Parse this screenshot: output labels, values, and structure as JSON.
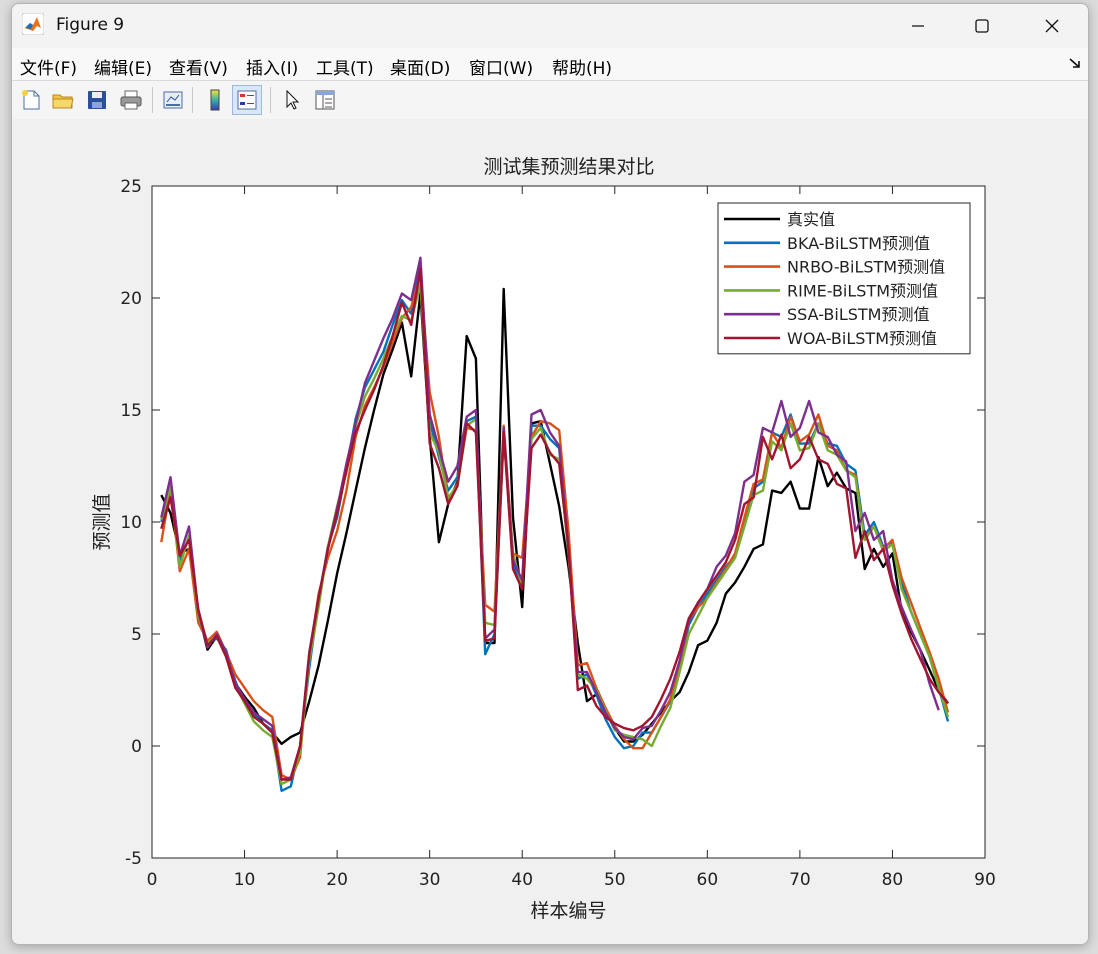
{
  "window": {
    "title": "Figure 9"
  },
  "menu": [
    "文件(F)",
    "编辑(E)",
    "查看(V)",
    "插入(I)",
    "工具(T)",
    "桌面(D)",
    "窗口(W)",
    "帮助(H)"
  ],
  "toolbar": [
    "new-figure",
    "open-file",
    "save",
    "print",
    "link-plot",
    "colorbar",
    "legend",
    "edit-plot",
    "property-inspector"
  ],
  "chart_data": {
    "type": "line",
    "title": "测试集预测结果对比",
    "xlabel": "样本编号",
    "ylabel": "预测值",
    "xlim": [
      0,
      90
    ],
    "ylim": [
      -5,
      25
    ],
    "xticks": [
      0,
      10,
      20,
      30,
      40,
      50,
      60,
      70,
      80,
      90
    ],
    "yticks": [
      -5,
      0,
      5,
      10,
      15,
      20,
      25
    ],
    "legend_position": "top-right",
    "grid": false,
    "x": [
      1,
      2,
      3,
      4,
      5,
      6,
      7,
      8,
      9,
      10,
      11,
      12,
      13,
      14,
      15,
      16,
      17,
      18,
      19,
      20,
      21,
      22,
      23,
      24,
      25,
      26,
      27,
      28,
      29,
      30,
      31,
      32,
      33,
      34,
      35,
      36,
      37,
      38,
      39,
      40,
      41,
      42,
      43,
      44,
      45,
      46,
      47,
      48,
      49,
      50,
      51,
      52,
      53,
      54,
      55,
      56,
      57,
      58,
      59,
      60,
      61,
      62,
      63,
      64,
      65,
      66,
      67,
      68,
      69,
      70,
      71,
      72,
      73,
      74,
      75,
      76,
      77,
      78,
      79,
      80,
      81,
      82,
      83,
      84,
      85,
      86
    ],
    "series": [
      {
        "name": "真实值",
        "color": "#000000",
        "values": [
          11.2,
          10.4,
          8.6,
          8.8,
          6.0,
          4.3,
          4.9,
          4.0,
          2.8,
          2.2,
          1.7,
          1.0,
          0.6,
          0.1,
          0.4,
          0.6,
          2.0,
          3.6,
          5.6,
          7.7,
          9.5,
          11.4,
          13.3,
          15.0,
          16.6,
          17.7,
          18.9,
          16.5,
          20.2,
          13.8,
          9.1,
          10.8,
          11.8,
          18.3,
          17.3,
          4.6,
          4.6,
          20.4,
          10.2,
          6.2,
          14.4,
          14.5,
          12.6,
          10.7,
          8.0,
          4.6,
          2.0,
          2.3,
          1.5,
          0.8,
          0.2,
          0.2,
          0.5,
          1.0,
          1.5,
          2.0,
          2.4,
          3.3,
          4.5,
          4.7,
          5.5,
          6.8,
          7.3,
          8.0,
          8.8,
          9.0,
          11.4,
          11.3,
          11.8,
          10.6,
          10.6,
          12.9,
          11.6,
          12.2,
          11.5,
          11.3,
          7.9,
          8.8,
          8.0,
          8.6,
          6.0,
          5.1,
          4.3,
          3.4,
          2.5,
          1.9
        ]
      },
      {
        "name": "BKA-BiLSTM预测值",
        "color": "#0072BD",
        "values": [
          10.0,
          11.3,
          8.3,
          9.3,
          5.9,
          4.6,
          4.8,
          4.3,
          2.9,
          1.9,
          1.4,
          1.0,
          0.7,
          -2.0,
          -1.8,
          0.0,
          3.5,
          6.5,
          8.9,
          10.2,
          12.4,
          14.6,
          16.0,
          16.8,
          17.6,
          18.8,
          19.9,
          19.3,
          21.5,
          14.5,
          12.9,
          11.4,
          12.0,
          14.5,
          14.7,
          4.1,
          5.0,
          14.0,
          8.1,
          7.2,
          14.3,
          14.3,
          13.7,
          13.3,
          8.6,
          3.0,
          3.2,
          2.3,
          1.2,
          0.4,
          -0.1,
          0.0,
          0.6,
          0.6,
          1.3,
          2.0,
          3.6,
          5.4,
          6.2,
          6.8,
          7.4,
          8.0,
          8.5,
          10.0,
          11.5,
          11.8,
          14.0,
          13.8,
          14.8,
          13.5,
          13.5,
          14.4,
          13.5,
          13.4,
          12.6,
          12.3,
          9.4,
          10.0,
          8.9,
          9.1,
          7.3,
          6.0,
          5.0,
          4.0,
          2.6,
          1.1
        ]
      },
      {
        "name": "NRBO-BiLSTM预测值",
        "color": "#D95319",
        "values": [
          9.1,
          11.5,
          7.8,
          8.8,
          5.5,
          4.7,
          5.1,
          4.2,
          3.2,
          2.6,
          2.0,
          1.6,
          1.3,
          -1.3,
          -1.5,
          -0.5,
          4.0,
          6.8,
          8.4,
          9.6,
          11.4,
          13.8,
          15.2,
          16.0,
          16.9,
          18.0,
          19.1,
          19.6,
          21.0,
          15.8,
          13.8,
          11.0,
          11.7,
          14.2,
          14.1,
          6.3,
          6.0,
          14.3,
          8.6,
          8.4,
          13.8,
          14.5,
          14.4,
          14.1,
          9.6,
          3.6,
          3.7,
          2.6,
          1.7,
          0.9,
          0.3,
          -0.1,
          -0.1,
          0.6,
          1.3,
          2.1,
          3.6,
          5.6,
          6.2,
          6.6,
          7.3,
          7.9,
          8.6,
          10.2,
          11.7,
          11.9,
          14.0,
          13.3,
          14.7,
          13.6,
          13.9,
          14.8,
          13.4,
          13.2,
          12.3,
          12.1,
          9.2,
          9.8,
          8.8,
          9.2,
          7.5,
          6.4,
          5.3,
          4.2,
          3.0,
          1.5
        ]
      },
      {
        "name": "RIME-BiLSTM预测值",
        "color": "#77AC30",
        "values": [
          10.1,
          11.6,
          8.0,
          9.4,
          5.8,
          4.6,
          4.9,
          4.0,
          2.7,
          1.9,
          1.1,
          0.7,
          0.4,
          -1.7,
          -1.5,
          -0.3,
          3.8,
          6.2,
          8.9,
          10.7,
          12.2,
          14.3,
          15.6,
          16.4,
          17.3,
          18.3,
          19.2,
          19.0,
          20.6,
          14.0,
          13.1,
          11.1,
          11.6,
          14.3,
          14.6,
          5.5,
          5.4,
          13.8,
          8.6,
          7.1,
          13.7,
          14.2,
          13.0,
          12.8,
          8.6,
          3.2,
          3.0,
          2.5,
          1.6,
          0.7,
          0.5,
          0.4,
          0.3,
          0.0,
          0.9,
          1.7,
          3.3,
          5.0,
          5.8,
          6.6,
          7.2,
          7.8,
          8.4,
          9.8,
          11.2,
          11.4,
          13.6,
          13.2,
          14.4,
          13.2,
          13.3,
          14.4,
          13.2,
          13.0,
          12.3,
          12.0,
          9.2,
          9.8,
          8.7,
          9.0,
          7.0,
          6.0,
          5.0,
          4.0,
          2.6,
          1.3
        ]
      },
      {
        "name": "SSA-BiLSTM预测值",
        "color": "#7E2F8E",
        "values": [
          10.2,
          12.0,
          8.5,
          9.8,
          6.0,
          4.4,
          5.0,
          4.2,
          2.8,
          2.1,
          1.5,
          1.2,
          0.9,
          -1.5,
          -1.4,
          0.0,
          4.2,
          6.6,
          8.8,
          10.6,
          12.6,
          14.4,
          16.2,
          17.2,
          18.2,
          19.1,
          20.2,
          19.9,
          21.8,
          14.8,
          13.3,
          11.8,
          12.5,
          14.7,
          15.0,
          4.8,
          5.2,
          14.2,
          8.3,
          7.4,
          14.8,
          15.0,
          14.0,
          13.4,
          8.8,
          3.3,
          3.3,
          2.4,
          1.5,
          0.8,
          0.4,
          0.3,
          0.8,
          0.9,
          1.6,
          2.4,
          3.8,
          5.6,
          6.4,
          7.0,
          8.0,
          8.5,
          9.5,
          11.8,
          12.1,
          14.2,
          14.0,
          15.4,
          13.8,
          14.2,
          15.4,
          14.0,
          13.8,
          13.0,
          12.7,
          9.6,
          10.4,
          9.2,
          9.6,
          7.4,
          6.2,
          5.2,
          4.3,
          2.8,
          1.6
        ]
      },
      {
        "name": "WOA-BiLSTM预测值",
        "color": "#A2142F",
        "values": [
          9.7,
          11.1,
          8.5,
          9.2,
          6.1,
          4.5,
          4.9,
          4.0,
          2.6,
          2.0,
          1.3,
          1.0,
          0.6,
          -1.5,
          -1.5,
          0.0,
          4.1,
          6.6,
          8.8,
          10.4,
          12.3,
          14.0,
          15.0,
          15.9,
          17.0,
          18.3,
          19.8,
          18.8,
          21.3,
          13.5,
          12.4,
          10.8,
          11.6,
          14.4,
          14.0,
          4.7,
          4.8,
          14.0,
          7.9,
          7.0,
          13.3,
          13.9,
          13.1,
          12.6,
          8.8,
          2.5,
          2.7,
          1.8,
          1.3,
          1.0,
          0.8,
          0.7,
          0.9,
          1.3,
          2.1,
          3.0,
          4.2,
          5.7,
          6.4,
          7.0,
          7.6,
          8.2,
          9.2,
          10.8,
          11.1,
          13.8,
          12.8,
          13.9,
          12.4,
          12.8,
          13.8,
          12.8,
          12.6,
          11.7,
          11.5,
          8.4,
          9.6,
          8.3,
          8.8,
          7.2,
          5.9,
          4.8,
          3.9,
          3.0,
          2.4,
          1.9
        ]
      }
    ]
  }
}
